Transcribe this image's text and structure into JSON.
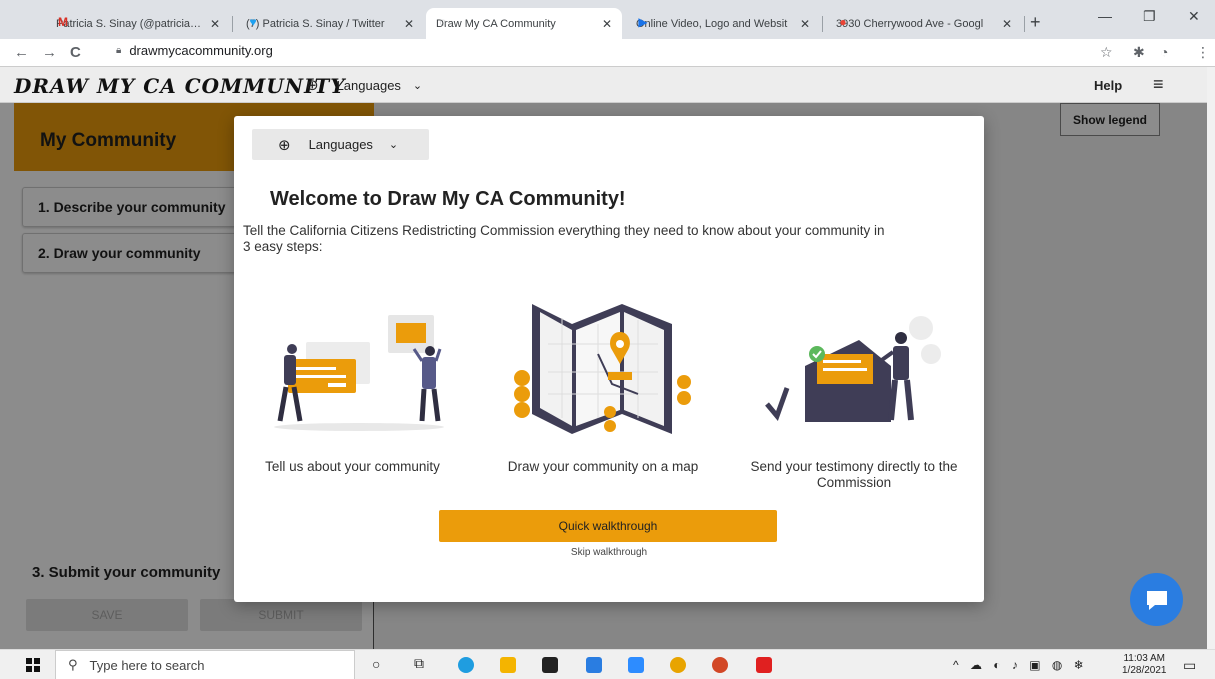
{
  "browser": {
    "tabs": [
      {
        "title": "Patricia S. Sinay (@patricia_sina",
        "icon": "gmail-icon",
        "color": "#d93025",
        "glyph": "M"
      },
      {
        "title": "(7) Patricia S. Sinay / Twitter",
        "icon": "twitter-icon",
        "color": "#1da1f2",
        "glyph": "♥"
      },
      {
        "title": "Draw My CA Community",
        "icon": "loading-icon",
        "color": "#9aa0a6",
        "glyph": "◌"
      },
      {
        "title": "Online Video, Logo and Websit",
        "icon": "play-icon",
        "color": "#1a73e8",
        "glyph": "▶"
      },
      {
        "title": "3930 Cherrywood Ave - Googl",
        "icon": "map-pin-icon",
        "color": "#ea4335",
        "glyph": "●"
      }
    ],
    "url": "drawmycacommunity.org"
  },
  "header": {
    "logo": "DRAW MY CA COMMUNITY",
    "languages": "Languages",
    "help": "Help"
  },
  "sidebar": {
    "title": "My Community",
    "step1": "1. Describe your community",
    "step2": "2. Draw your community",
    "step3": "3. Submit your community",
    "save": "SAVE",
    "submit": "SUBMIT"
  },
  "map": {
    "show_legend": "Show legend"
  },
  "modal": {
    "languages": "Languages",
    "title": "Welcome to Draw My CA Community!",
    "desc_line1": "Tell the California Citizens Redistricting Commission everything they need to know about your community in",
    "desc_line2": "3 easy steps:",
    "cap1": "Tell us about your community",
    "cap2": "Draw your community on a map",
    "cap3_line1": "Send your testimony directly to the",
    "cap3_line2": "Commission",
    "quick": "Quick walkthrough",
    "skip": "Skip walkthrough"
  },
  "taskbar": {
    "search_placeholder": "Type here to search",
    "time": "11:03 AM",
    "date": "1/28/2021"
  },
  "colors": {
    "accent": "#eb9c0b",
    "dark": "#3f3d56",
    "chat": "#2a7de1"
  }
}
